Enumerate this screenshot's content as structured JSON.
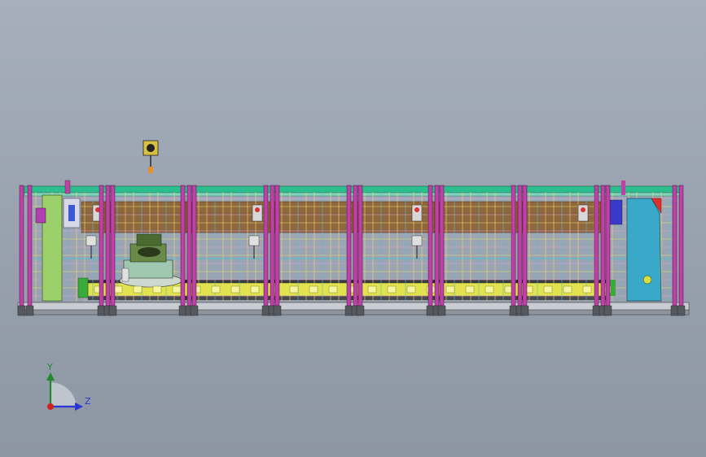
{
  "viewport": {
    "background_top": "#a6afbb",
    "background_bottom": "#8d96a3"
  },
  "model": {
    "description_colors": {
      "frame_post": "#c040a8",
      "frame_post_dark": "#6a3a6a",
      "mesh_line": "#f0e060",
      "mesh_cross": "#50c0d0",
      "top_rail": "#2bbf8f",
      "wood_beam": "#8a5a2a",
      "conveyor": "#e8e83a",
      "base_plate": "#d8dce0",
      "robot_green": "#7acb5a",
      "cabinet_blue": "#3aa8c8",
      "accent_red": "#e03030"
    },
    "bays": 7
  },
  "triad": {
    "y_label": "Y",
    "z_label": "Z",
    "y_color": "#1e8a2a",
    "z_color": "#2a35d8",
    "x_color": "#d02020"
  }
}
